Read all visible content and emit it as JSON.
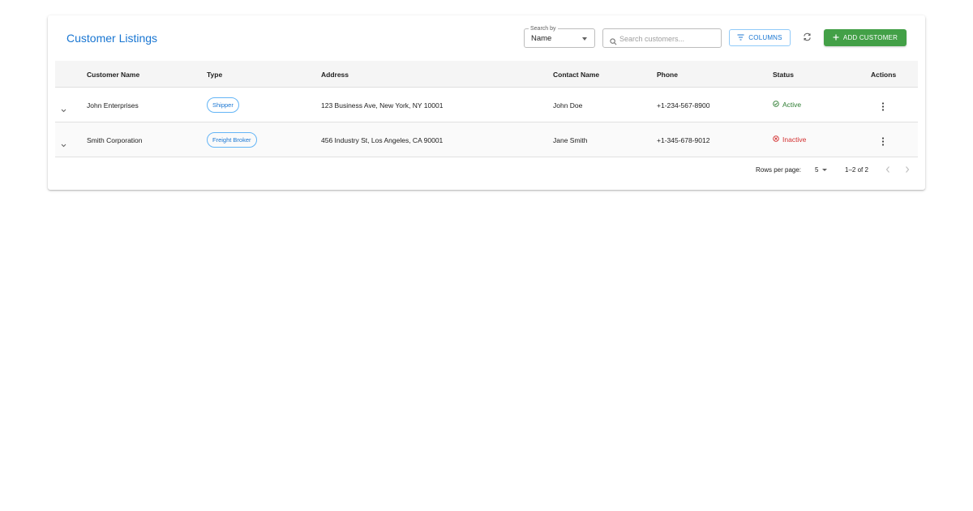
{
  "header": {
    "title": "Customer Listings",
    "search_by_label": "Search by",
    "search_by_value": "Name",
    "search_placeholder": "Search customers...",
    "columns_label": "COLUMNS",
    "add_customer_label": "ADD CUSTOMER"
  },
  "table": {
    "columns": [
      "Customer Name",
      "Type",
      "Address",
      "Contact Name",
      "Phone",
      "Status",
      "Actions"
    ],
    "rows": [
      {
        "name": "John Enterprises",
        "type": "Shipper",
        "address": "123 Business Ave, New York, NY 10001",
        "contact": "John Doe",
        "phone": "+1-234-567-8900",
        "status": "Active"
      },
      {
        "name": "Smith Corporation",
        "type": "Freight Broker",
        "address": "456 Industry St, Los Angeles, CA 90001",
        "contact": "Jane Smith",
        "phone": "+1-345-678-9012",
        "status": "Inactive"
      }
    ]
  },
  "pagination": {
    "rows_per_page_label": "Rows per page:",
    "rows_per_page_value": "5",
    "range": "1–2 of 2"
  },
  "colors": {
    "primary": "#1976d2",
    "add_button": "#43a047",
    "active": "#2e7d32",
    "inactive": "#d32f2f"
  },
  "icons": [
    "search-icon",
    "filter-icon",
    "refresh-icon",
    "plus-icon",
    "chevron-down-icon",
    "check-circle-icon",
    "cancel-circle-icon",
    "more-vert-icon",
    "chevron-left-icon",
    "chevron-right-icon"
  ]
}
